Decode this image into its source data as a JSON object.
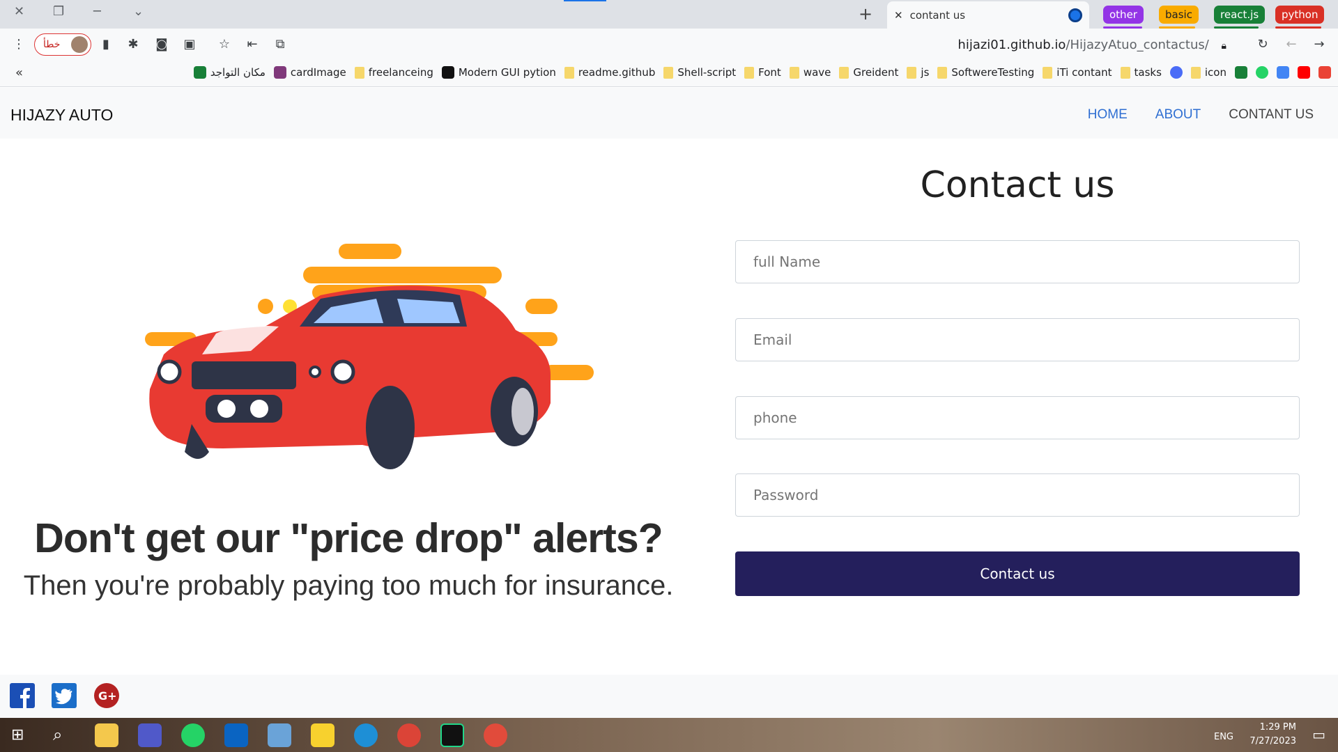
{
  "browser": {
    "tab_title": "contant us",
    "groups": [
      {
        "label": "other",
        "color": "#9334e6"
      },
      {
        "label": "basic",
        "color": "#f9ab00"
      },
      {
        "label": "react.js",
        "color": "#188038"
      },
      {
        "label": "python",
        "color": "#d93025"
      }
    ],
    "profile_label": "خطأ",
    "url_host": "hijazi01.github.io",
    "url_path": "/HijazyAtuo_contactus/",
    "bookmarks": [
      "مكان التواجد",
      "cardImage",
      "freelanceing",
      "Modern GUI pytion",
      "readme.github",
      "Shell-script",
      "Font",
      "wave",
      "Greident",
      "js",
      "SoftwereTesting",
      "iTi contant",
      "tasks",
      "icon"
    ],
    "bookmarks_overflow": "«"
  },
  "nav": {
    "brand": "HIJAZY AUTO",
    "links": [
      "HOME",
      "ABOUT",
      "CONTANT US"
    ]
  },
  "hero": {
    "title": "Don't get our \"price drop\" alerts?",
    "subtitle": "Then you're probably paying too much for insurance."
  },
  "form": {
    "heading": "Contact us",
    "fields": [
      "full Name",
      "Email",
      "phone",
      "Password"
    ],
    "submit_label": "Contact us"
  },
  "footer": {
    "icons": [
      "facebook-icon",
      "twitter-icon",
      "google-plus-icon"
    ]
  },
  "taskbar": {
    "time": "1:29 PM",
    "date": "7/27/2023",
    "lang": "ENG"
  }
}
